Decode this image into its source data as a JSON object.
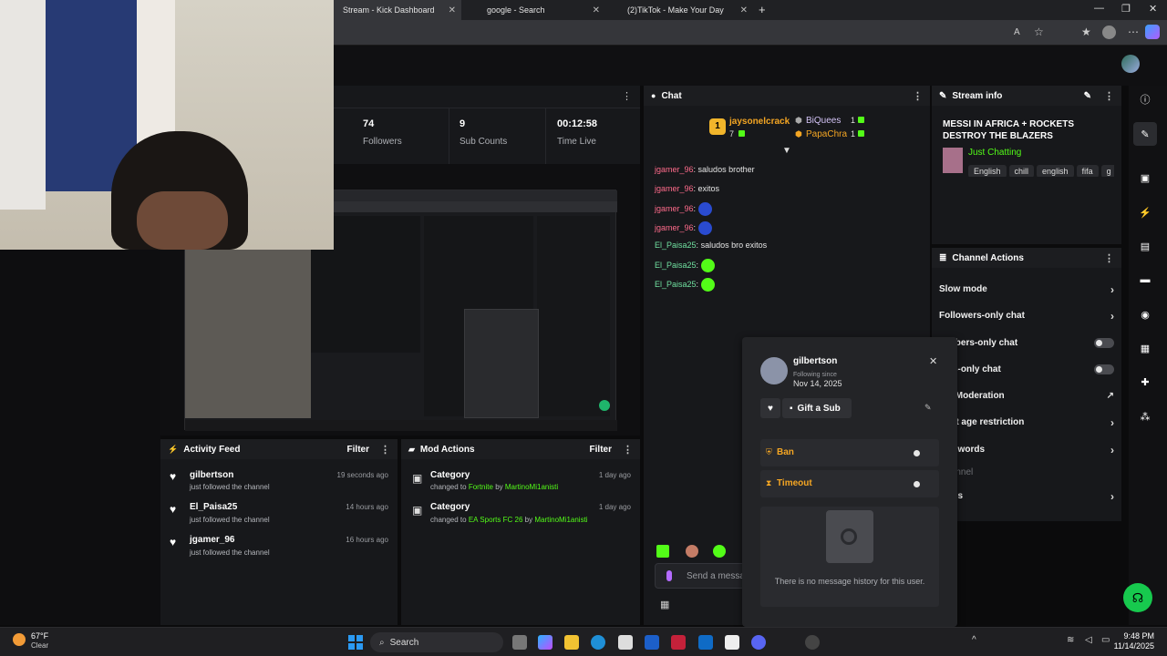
{
  "browser": {
    "tabs": [
      {
        "label": "Stream - Kick Dashboard"
      },
      {
        "label": "google - Search"
      },
      {
        "label": "(2)TikTok - Make Your Day"
      }
    ]
  },
  "stats": [
    {
      "value": "74",
      "label": "Followers"
    },
    {
      "value": "9",
      "label": "Sub Counts"
    },
    {
      "value": "00:12:58",
      "label": "Time Live"
    }
  ],
  "chat": {
    "title": "Chat",
    "leaderboard": [
      {
        "name": "jaysonelcrack",
        "count": "7"
      },
      {
        "name": "BiQuees",
        "count": "1"
      },
      {
        "name": "PapaChra",
        "count": "1"
      }
    ],
    "messages": [
      {
        "user": "jgamer_96",
        "text": "saludos brother",
        "color": "red"
      },
      {
        "user": "jgamer_96",
        "text": "exitos",
        "color": "red"
      },
      {
        "user": "jgamer_96",
        "text": "",
        "color": "red"
      },
      {
        "user": "jgamer_96",
        "text": "",
        "color": "red"
      },
      {
        "user": "El_Paisa25",
        "text": "saludos bro exitos",
        "color": "green"
      },
      {
        "user": "El_Paisa25",
        "text": "",
        "color": "green"
      },
      {
        "user": "El_Paisa25",
        "text": "",
        "color": "green"
      }
    ],
    "input_placeholder": "Send a messa"
  },
  "stream_info": {
    "title": "Stream info",
    "stream_title": "MESSI IN AFRICA + ROCKETS DESTROY THE BLAZERS",
    "category": "Just Chatting",
    "tags": [
      "English",
      "chill",
      "english",
      "fifa",
      "g"
    ]
  },
  "channel_actions": {
    "title": "Channel Actions",
    "items": [
      {
        "label": "Slow mode",
        "kind": "chevron"
      },
      {
        "label": "Followers-only chat",
        "kind": "chevron"
      },
      {
        "label": "scribers-only chat",
        "kind": "toggle"
      },
      {
        "label": "otes-only chat",
        "kind": "toggle"
      },
      {
        "label": "hat Moderation",
        "kind": "chart"
      },
      {
        "label": "ount age restriction",
        "kind": "chevron"
      },
      {
        "label": "ned words",
        "kind": "chevron"
      },
      {
        "label": "Channel",
        "kind": "disabled"
      },
      {
        "label": "goals",
        "kind": "chevron"
      }
    ]
  },
  "activity_feed": {
    "title": "Activity Feed",
    "filter": "Filter",
    "items": [
      {
        "name": "gilbertson",
        "sub": "just followed the channel",
        "time": "19 seconds ago"
      },
      {
        "name": "El_Paisa25",
        "sub": "just followed the channel",
        "time": "14 hours ago"
      },
      {
        "name": "jgamer_96",
        "sub": "just followed the channel",
        "time": "16 hours ago"
      }
    ]
  },
  "mod_actions": {
    "title": "Mod Actions",
    "filter": "Filter",
    "items": [
      {
        "title": "Category",
        "prefix": "changed to",
        "game": "Fortnite",
        "by": "by",
        "mod": "MartinoMi1anisti",
        "time": "1 day ago"
      },
      {
        "title": "Category",
        "prefix": "changed to",
        "game": "EA Sports FC 26",
        "by": "by",
        "mod": "MartinoMi1anisti",
        "time": "1 day ago"
      }
    ]
  },
  "user_popup": {
    "username": "gilbertson",
    "following_label": "Following since",
    "following_date": "Nov 14, 2025",
    "gift_label": "Gift a Sub",
    "ban_label": "Ban",
    "timeout_label": "Timeout",
    "empty_text": "There is no message history for this user."
  },
  "taskbar": {
    "weather_temp": "67°F",
    "weather_desc": "Clear",
    "search": "Search",
    "time": "9:48 PM",
    "date": "11/14/2025"
  },
  "colors": {
    "kick_green": "#53fc18",
    "ban_orange": "#f5a623",
    "panel": "#17181b"
  }
}
